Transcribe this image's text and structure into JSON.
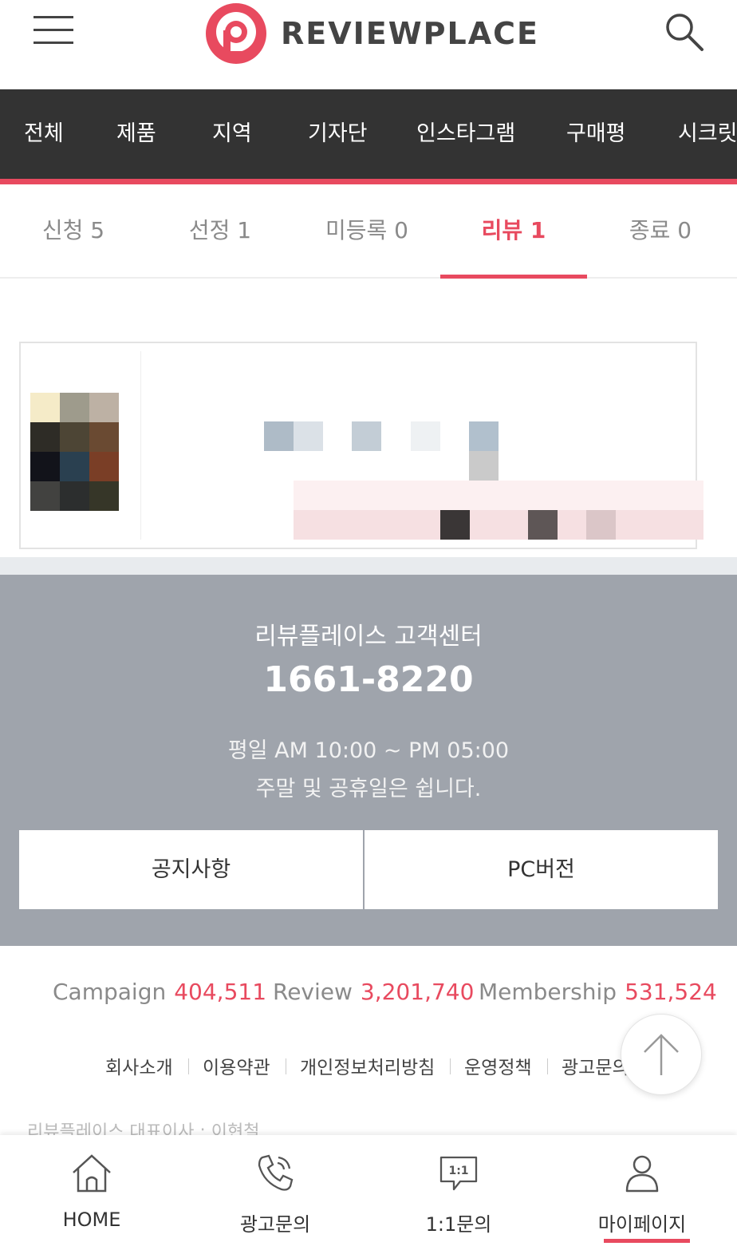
{
  "header": {
    "brand": "REVIEWPLACE",
    "brand_color": "#e84a5f",
    "menu_icon": "hamburger-menu-icon",
    "search_icon": "search-icon"
  },
  "category_nav": {
    "items": [
      "전체",
      "제품",
      "지역",
      "기자단",
      "인스타그램",
      "구매평",
      "시크릿"
    ]
  },
  "status_tabs": {
    "items": [
      {
        "label": "신청 5",
        "active": false
      },
      {
        "label": "선정 1",
        "active": false
      },
      {
        "label": "미등록 0",
        "active": false
      },
      {
        "label": "리뷰 1",
        "active": true
      },
      {
        "label": "종료 0",
        "active": false
      }
    ]
  },
  "customer_center": {
    "title": "리뷰플레이스 고객센터",
    "phone": "1661-8220",
    "hours": "평일 AM 10:00 ~ PM 05:00",
    "weekend": "주말 및 공휴일은 쉽니다.",
    "notice_button": "공지사항",
    "pc_button": "PC버전"
  },
  "stats": [
    {
      "label": "Campaign",
      "value": "404,511"
    },
    {
      "label": "Review",
      "value": "3,201,740"
    },
    {
      "label": "Membership",
      "value": "531,524"
    }
  ],
  "footer_links": [
    "회사소개",
    "이용약관",
    "개인정보처리방침",
    "운영정책",
    "광고문의"
  ],
  "company_line": "리뷰플레이스 대표이사 : 이현철",
  "bottom_nav": [
    {
      "label": "HOME",
      "icon": "home-icon",
      "active": false
    },
    {
      "label": "광고문의",
      "icon": "phone-icon",
      "active": false
    },
    {
      "label": "1:1문의",
      "icon": "chat-bubble-icon",
      "active": false
    },
    {
      "label": "마이페이지",
      "icon": "user-icon",
      "active": true
    }
  ],
  "colors": {
    "accent": "#e84a5f",
    "nav_bg": "#333333",
    "cs_bg": "#9fa4ac"
  }
}
